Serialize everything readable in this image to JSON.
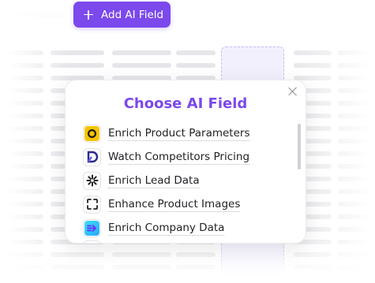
{
  "toolbar": {
    "add_label": "Add AI Field"
  },
  "modal": {
    "title": "Choose AI Field",
    "items": [
      {
        "label": "Enrich Product Parameters",
        "icon": "yellow-o-icon"
      },
      {
        "label": "Watch Competitors Pricing",
        "icon": "d-logo-icon"
      },
      {
        "label": "Enrich Lead Data",
        "icon": "sparkle-icon"
      },
      {
        "label": "Enhance Product Images",
        "icon": "frame-icon"
      },
      {
        "label": "Enrich Company Data",
        "icon": "arrow-logo-icon"
      }
    ]
  },
  "colors": {
    "accent": "#7b49ec",
    "text": "#222226"
  }
}
